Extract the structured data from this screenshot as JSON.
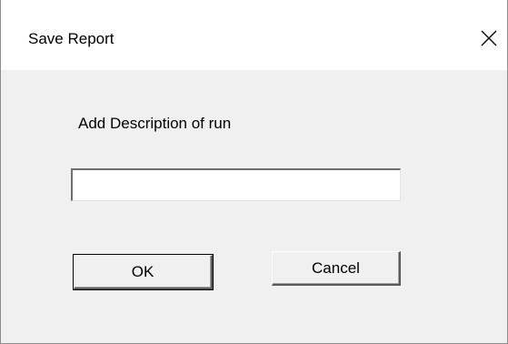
{
  "dialog": {
    "title": "Save Report",
    "close_icon": "close-icon",
    "prompt_label": "Add Description of run",
    "description_input": {
      "value": "",
      "placeholder": ""
    },
    "ok_label": "OK",
    "cancel_label": "Cancel"
  }
}
